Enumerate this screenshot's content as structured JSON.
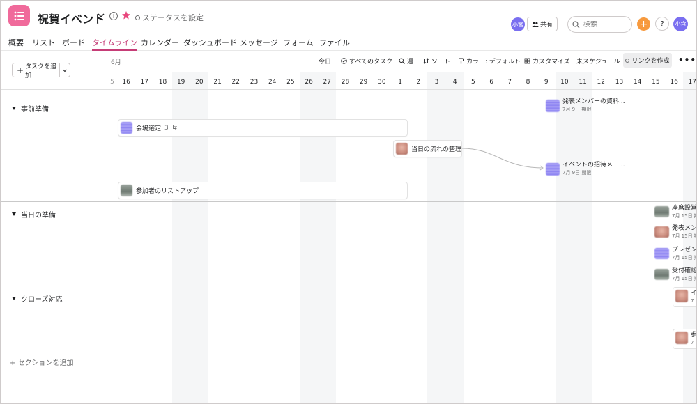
{
  "header": {
    "project_title": "祝賀イベント",
    "status_label": "ステータスを設定",
    "share_label": "共有",
    "search_placeholder": "検索",
    "add_symbol": "+",
    "help_symbol": "?",
    "info_symbol": "i",
    "member_initials": "小宮",
    "user_initials": "小宮",
    "accent_color": "#f06a9b",
    "star_color": "#e8467c"
  },
  "nav": {
    "tabs": [
      {
        "label": "概要",
        "active": false
      },
      {
        "label": "リスト",
        "active": false
      },
      {
        "label": "ボード",
        "active": false
      },
      {
        "label": "タイムライン",
        "active": true
      },
      {
        "label": "カレンダー",
        "active": false
      },
      {
        "label": "ダッシュボード",
        "active": false
      },
      {
        "label": "メッセージ",
        "active": false
      },
      {
        "label": "フォーム",
        "active": false
      },
      {
        "label": "ファイル",
        "active": false
      }
    ],
    "active_color": "#c63d77"
  },
  "toolbar": {
    "today": "今日",
    "all_tasks": "すべてのタスク",
    "week": "週",
    "sort": "ソート",
    "color": "カラー: デフォルト",
    "customize": "カスタマイズ",
    "unscheduled": "未スケジュール",
    "create_link": "リンクを作成",
    "more": "•••",
    "add_task": "タスクを追加"
  },
  "timeline": {
    "month": "6月",
    "days": [
      "5",
      "16",
      "17",
      "18",
      "19",
      "20",
      "21",
      "22",
      "23",
      "24",
      "25",
      "26",
      "27",
      "28",
      "29",
      "30",
      "1",
      "2",
      "3",
      "4",
      "5",
      "6",
      "7",
      "8",
      "9",
      "10",
      "11",
      "12",
      "13",
      "14",
      "15",
      "16",
      "17"
    ],
    "weekend_indices": [
      4,
      5,
      11,
      12,
      18,
      19,
      25,
      26,
      32
    ]
  },
  "sections": [
    {
      "name": "事前準備"
    },
    {
      "name": "当日の準備"
    },
    {
      "name": "クローズ対応"
    }
  ],
  "add_section_label": "+ セクションを追加",
  "tasks": {
    "venue": {
      "name": "会場選定",
      "subtasks": "3"
    },
    "flow": {
      "name": "当日の流れの整理"
    },
    "attendees": {
      "name": "参加者のリストアップ"
    },
    "presenter_material": {
      "name": "発表メンバーの資料...",
      "due": "7月 9日 期限"
    },
    "invite": {
      "name": "イベントの招待メー...",
      "due": "7月 9日 期限"
    },
    "seating": {
      "name": "座席設営",
      "due": "7月 15日 期限"
    },
    "presenter2": {
      "name": "発表メンバ",
      "due": "7月 15日 期限"
    },
    "presentation": {
      "name": "プレゼン設",
      "due": "7月 15日 期限"
    },
    "reception": {
      "name": "受付確認",
      "due": "7月 15日 期限"
    },
    "close1": {
      "name": "イ",
      "due": "7"
    },
    "close2": {
      "name": "参",
      "due": "7"
    }
  }
}
